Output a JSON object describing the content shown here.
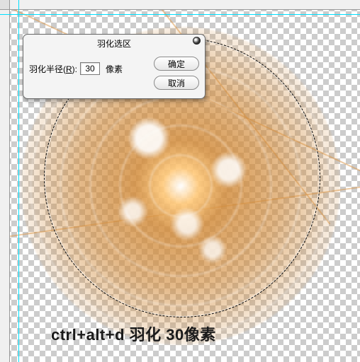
{
  "dialog": {
    "title": "羽化选区",
    "field_label_prefix": "羽化半径(",
    "field_hotkey": "R",
    "field_label_suffix": "):",
    "value": "30",
    "unit": "像素",
    "ok_label": "确定",
    "cancel_label": "取消"
  },
  "caption": "ctrl+alt+d  羽化 30像素",
  "colors": {
    "swirl_base": "#d28c3c",
    "guide": "#00e0ff"
  }
}
